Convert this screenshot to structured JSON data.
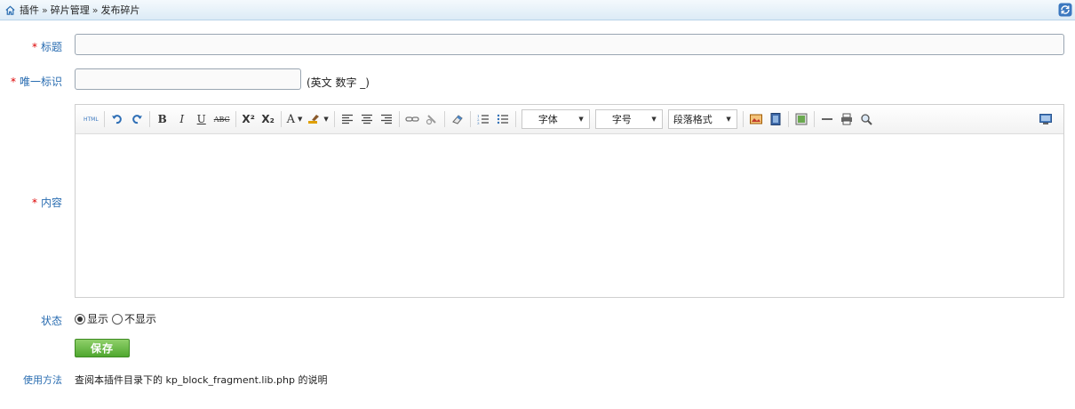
{
  "breadcrumb": [
    "插件",
    "碎片管理",
    "发布碎片"
  ],
  "breadcrumb_sep": "»",
  "form": {
    "title_label": "标题",
    "title_value": "",
    "key_label": "唯一标识",
    "key_value": "",
    "key_hint": "(英文 数字 _)",
    "content_label": "内容",
    "required_mark": "*",
    "status_label": "状态",
    "status_options": [
      "显示",
      "不显示"
    ],
    "status_selected": "显示",
    "save_label": "保存",
    "usage_label": "使用方法",
    "usage_text": "查阅本插件目录下的 kp_block_fragment.lib.php 的说明"
  },
  "editor": {
    "html_label": "HTML",
    "font_family_select": "字体",
    "font_size_select": "字号",
    "paragraph_select": "段落格式",
    "bold": "B",
    "italic": "I",
    "underline": "U",
    "strike": "ABC",
    "superscript": "X²",
    "subscript": "X₂",
    "font_color": "A"
  }
}
